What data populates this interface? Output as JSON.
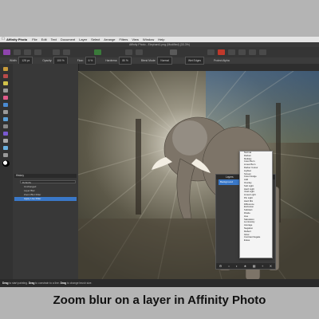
{
  "menubar": {
    "app_name": "Affinity Photo",
    "items": [
      "File",
      "Edit",
      "Text",
      "Document",
      "Layer",
      "Select",
      "Arrange",
      "Filters",
      "View",
      "Window",
      "Help"
    ]
  },
  "window": {
    "title": "Affinity Photo - Elephant1.png (Modified) (33.3%)"
  },
  "context_toolbar": {
    "size_label": "Width:",
    "size_value": "128 px",
    "opacity_label": "Opacity:",
    "opacity_value": "100 %",
    "flow_label": "Flow:",
    "flow_value": "6 %",
    "hardness_label": "Hardness:",
    "hardness_value": "80 %",
    "blend_mode_label": "Blend Mode:",
    "blend_mode_value": "Normal",
    "wet_edges_label": "Wet Edges",
    "protect_alpha_label": "Protect Alpha"
  },
  "left_panel": {
    "header": "History",
    "select_value": "Defaults",
    "items": [
      "Unchanged",
      "Layer Blur",
      "Zoom Blur Filter",
      "Apply Live Filter"
    ]
  },
  "layers_panel": {
    "tab": "Layers",
    "selected_layer": "Background"
  },
  "blend_dropdown": {
    "options": [
      "Normal",
      "Darken",
      "Multiply",
      "Color Burn",
      "Linear Burn",
      "Darker Colour",
      "Lighten",
      "Screen",
      "Color Dodge",
      "Add",
      "Overlay",
      "Soft Light",
      "Hard Light",
      "Vivid Light",
      "Linear Light",
      "Pin Light",
      "Hard Mix",
      "Difference",
      "Exclusion",
      "Subtract",
      "Divide",
      "Hue",
      "Saturation",
      "Luminosity",
      "Average",
      "Negation",
      "Reflect",
      "Glow",
      "Contrast Negate",
      "Erase"
    ]
  },
  "statusbar": {
    "text_1": "Drag",
    "text_2": "to start painting.",
    "text_3": "Drag",
    "text_4": "to constrain to a line.",
    "text_5": "Drag",
    "text_6": "to change brush size."
  },
  "caption": "Zoom blur on a layer in Affinity Photo",
  "colors": {
    "selection_blue": "#3a78c8",
    "chrome_dark": "#2e2e2e",
    "page_bg": "#b4b4b4"
  }
}
